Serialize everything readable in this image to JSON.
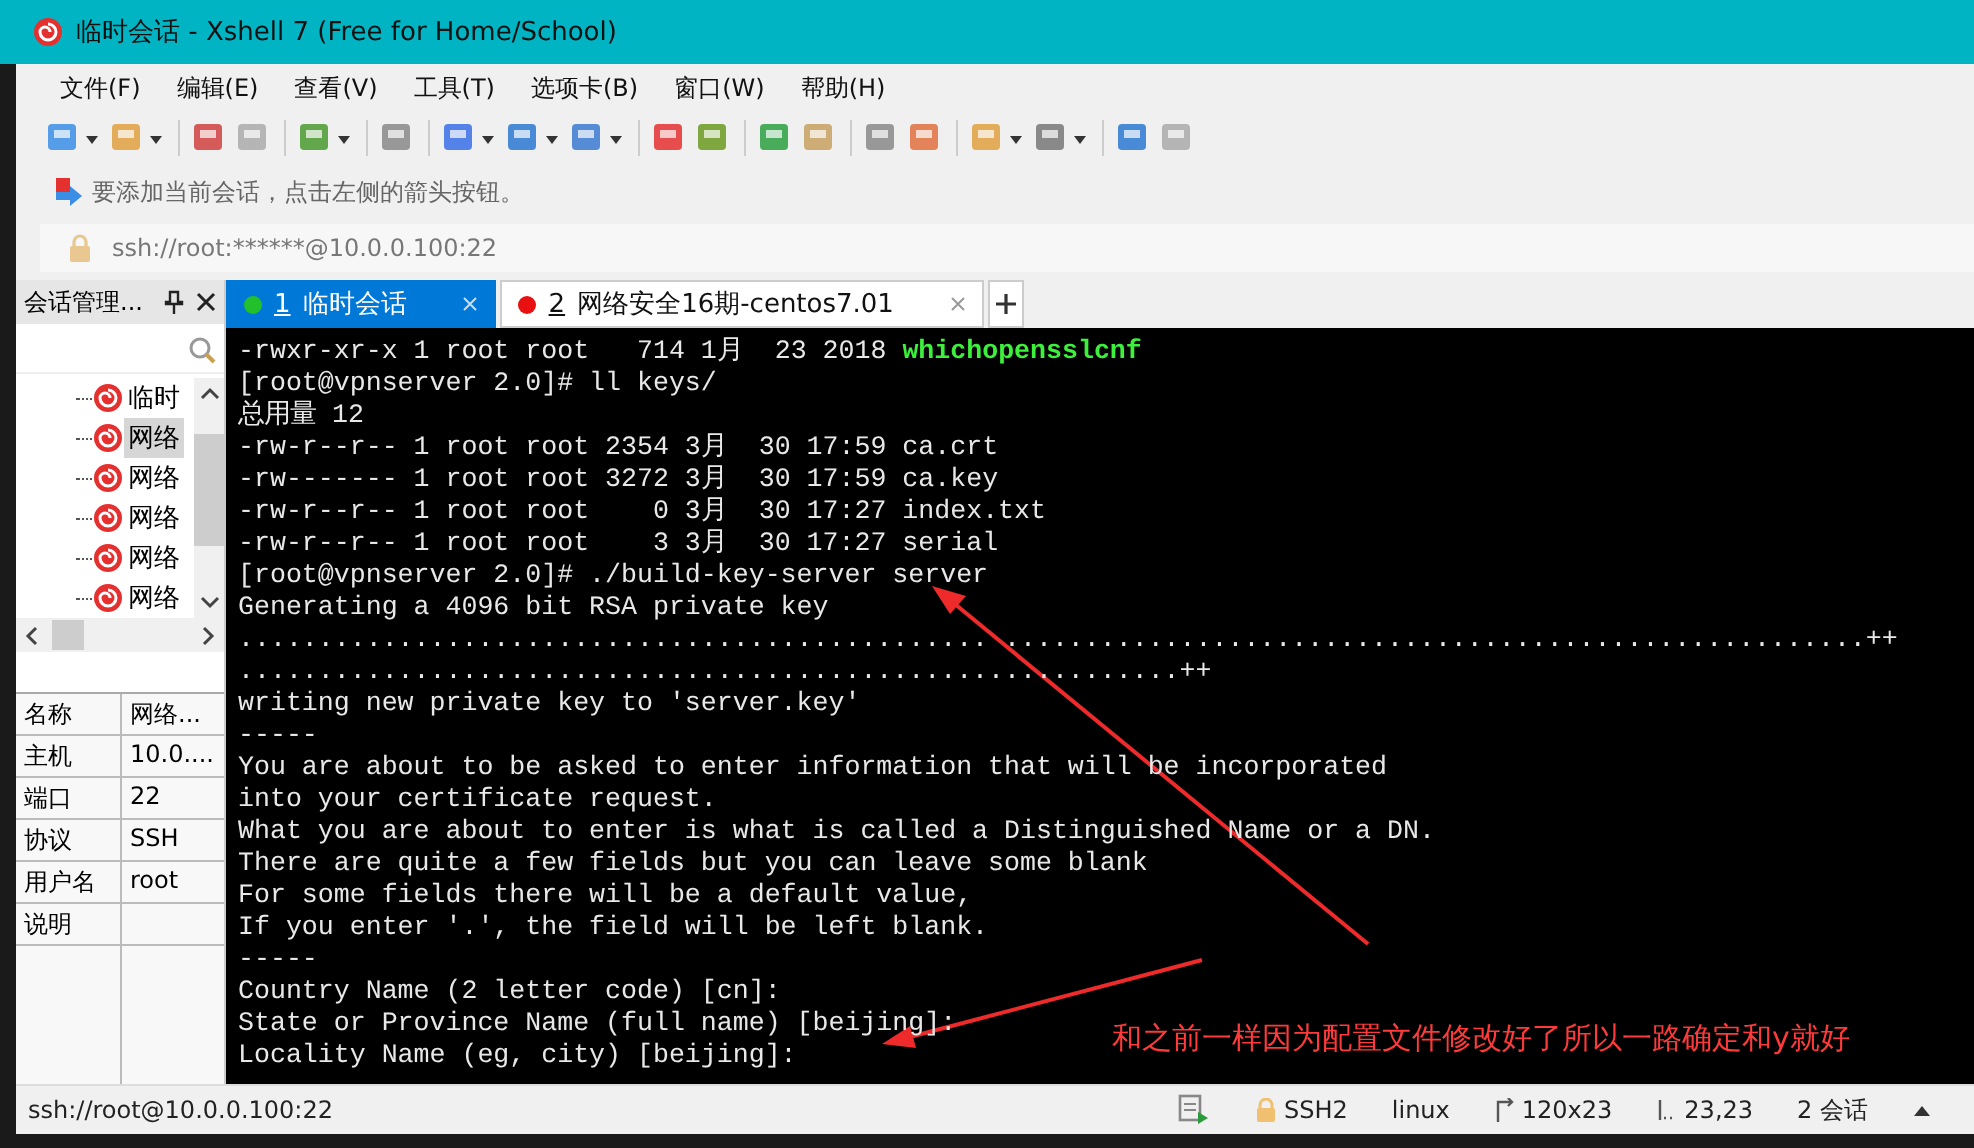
{
  "window": {
    "title": "临时会话 - Xshell 7 (Free for Home/School)"
  },
  "menu": [
    "文件(F)",
    "编辑(E)",
    "查看(V)",
    "工具(T)",
    "选项卡(B)",
    "窗口(W)",
    "帮助(H)"
  ],
  "hint": "要添加当前会话，点击左侧的箭头按钮。",
  "address": "ssh://root:******@10.0.0.100:22",
  "session_panel": {
    "title": "会话管理...",
    "tree": [
      {
        "label": "临时",
        "selected": false
      },
      {
        "label": "网络",
        "selected": true
      },
      {
        "label": "网络",
        "selected": false
      },
      {
        "label": "网络",
        "selected": false
      },
      {
        "label": "网络",
        "selected": false
      },
      {
        "label": "网络",
        "selected": false
      }
    ]
  },
  "properties": [
    {
      "name": "名称",
      "value": "网络..."
    },
    {
      "name": "主机",
      "value": "10.0...."
    },
    {
      "name": "端口",
      "value": "22"
    },
    {
      "name": "协议",
      "value": "SSH"
    },
    {
      "name": "用户名",
      "value": "root"
    },
    {
      "name": "说明"
    }
  ],
  "tabs": [
    {
      "number": "1",
      "label": "临时会话",
      "selected": true,
      "color": "#22c02a"
    },
    {
      "number": "2",
      "label": "网络安全16期-centos7.01",
      "selected": false,
      "color": "#e81010"
    }
  ],
  "terminal": {
    "lines": [
      {
        "parts": [
          {
            "text": "-rwxr-xr-x 1 root root   714 1月  23 2018 ",
            "kind": "plain"
          },
          {
            "text": "whichopensslcnf",
            "kind": "executable"
          }
        ]
      },
      {
        "parts": [
          {
            "text": "[root@vpnserver 2.0]# ll keys/",
            "kind": "plain"
          }
        ]
      },
      {
        "parts": [
          {
            "text": "总用量 12",
            "kind": "plain"
          }
        ]
      },
      {
        "parts": [
          {
            "text": "-rw-r--r-- 1 root root 2354 3月  30 17:59 ca.crt",
            "kind": "plain"
          }
        ]
      },
      {
        "parts": [
          {
            "text": "-rw------- 1 root root 3272 3月  30 17:59 ca.key",
            "kind": "plain"
          }
        ]
      },
      {
        "parts": [
          {
            "text": "-rw-r--r-- 1 root root    0 3月  30 17:27 index.txt",
            "kind": "plain"
          }
        ]
      },
      {
        "parts": [
          {
            "text": "-rw-r--r-- 1 root root    3 3月  30 17:27 serial",
            "kind": "plain"
          }
        ]
      },
      {
        "parts": [
          {
            "text": "[root@vpnserver 2.0]# ./build-key-server server",
            "kind": "plain"
          }
        ]
      },
      {
        "parts": [
          {
            "text": "Generating a 4096 bit RSA private key",
            "kind": "plain"
          }
        ]
      },
      {
        "parts": [
          {
            "text": "............................................... ......................................................++",
            "kind": "plain"
          }
        ]
      },
      {
        "parts": [
          {
            "text": "...........................................................++",
            "kind": "plain"
          }
        ]
      },
      {
        "parts": [
          {
            "text": "writing new private key to 'server.key'",
            "kind": "plain"
          }
        ]
      },
      {
        "parts": [
          {
            "text": "-----",
            "kind": "plain"
          }
        ]
      },
      {
        "parts": [
          {
            "text": "You are about to be asked to enter information that will be incorporated",
            "kind": "plain"
          }
        ]
      },
      {
        "parts": [
          {
            "text": "into your certificate request.",
            "kind": "plain"
          }
        ]
      },
      {
        "parts": [
          {
            "text": "What you are about to enter is what is called a Distinguished Name or a DN.",
            "kind": "plain"
          }
        ]
      },
      {
        "parts": [
          {
            "text": "There are quite a few fields but you can leave some blank",
            "kind": "plain"
          }
        ]
      },
      {
        "parts": [
          {
            "text": "For some fields there will be a default value,",
            "kind": "plain"
          }
        ]
      },
      {
        "parts": [
          {
            "text": "If you enter '.', the field will be left blank.",
            "kind": "plain"
          }
        ]
      },
      {
        "parts": [
          {
            "text": "-----",
            "kind": "plain"
          }
        ]
      },
      {
        "parts": [
          {
            "text": "Country Name (2 letter code) [cn]:",
            "kind": "plain"
          }
        ]
      },
      {
        "parts": [
          {
            "text": "State or Province Name (full name) [beijing]:",
            "kind": "plain"
          }
        ]
      },
      {
        "parts": [
          {
            "text": "Locality Name (eg, city) [beijing]:",
            "kind": "plain"
          }
        ]
      }
    ]
  },
  "annotation": {
    "text": "和之前一样因为配置文件修改好了所以一路确定和y就好"
  },
  "status_bar": {
    "address": "ssh://root@10.0.0.100:22",
    "protocol": "SSH2",
    "terminal_type": "linux",
    "size": "120x23",
    "cursor": "23,23",
    "sessions": "2 会话"
  }
}
